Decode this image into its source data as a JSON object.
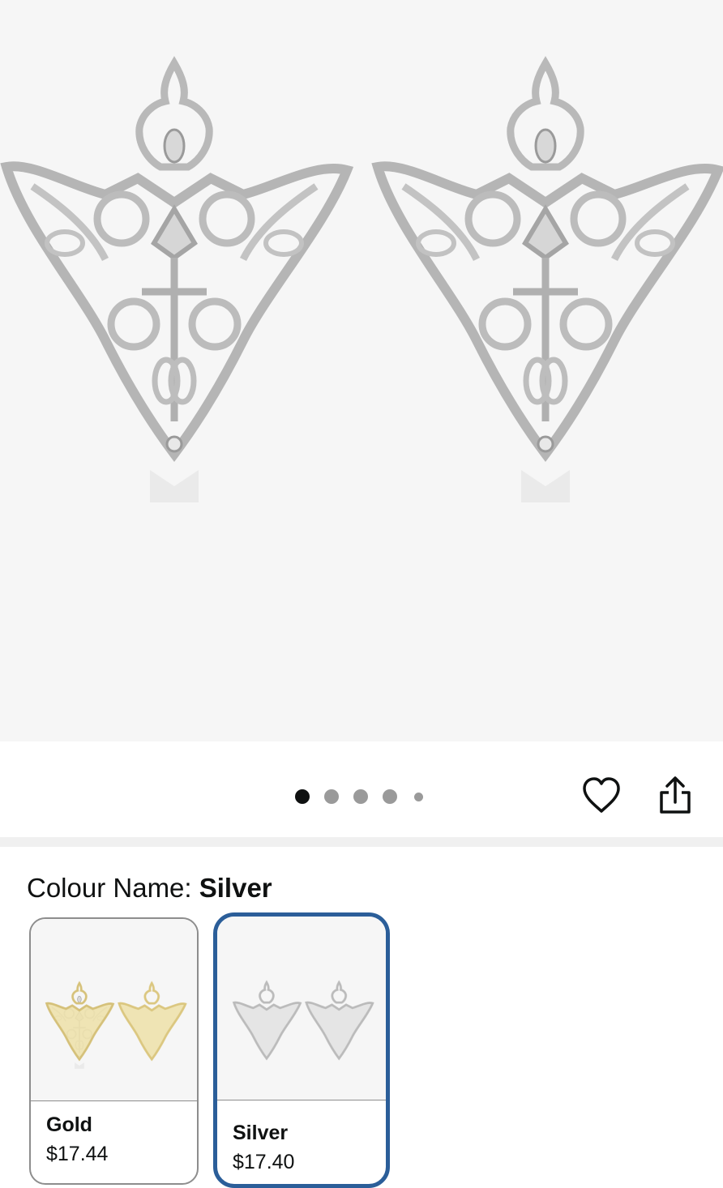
{
  "gallery": {
    "image_alt": "Silver filigree collar tips",
    "dots_total": 5,
    "active_dot": 1
  },
  "actions": {
    "wishlist_icon": "heart-outline-icon",
    "share_icon": "share-icon"
  },
  "variation": {
    "label": "Colour Name: ",
    "selected": "Silver",
    "options": [
      {
        "name": "Gold",
        "price": "$17.44",
        "image_color": "#e2cf88",
        "selected": false
      },
      {
        "name": "Silver",
        "price": "$17.40",
        "image_color": "#c9c9c9",
        "selected": true
      }
    ]
  },
  "colors": {
    "selected_border": "#2b5e99",
    "metal_silver": "#bdbdbd",
    "metal_gold": "#e2cf88",
    "hero_background": "#f6f6f6"
  }
}
